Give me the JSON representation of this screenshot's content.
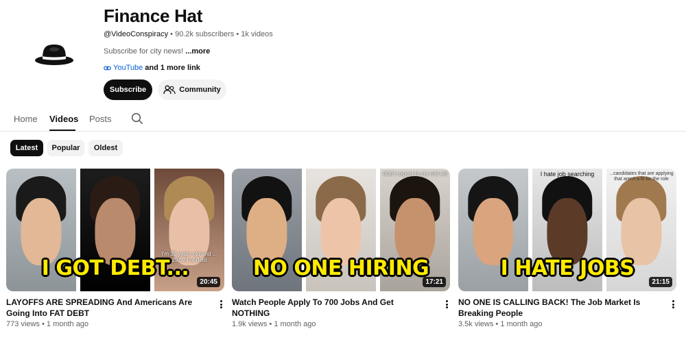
{
  "channel": {
    "title": "Finance Hat",
    "handle": "@VideoConspiracy",
    "subscribers": "90.2k subscribers",
    "videos_count": "1k videos",
    "separator": " • ",
    "description": "Subscribe for city news! ",
    "more_label": "...more",
    "link_label": "YouTube",
    "link_rest": "and 1 more link",
    "subscribe_label": "Subscribe",
    "community_label": "Community",
    "avatar_icon": "fedora-hat-icon"
  },
  "tabs": [
    {
      "label": "Home"
    },
    {
      "label": "Videos",
      "active": true
    },
    {
      "label": "Posts"
    }
  ],
  "chips": [
    {
      "label": "Latest",
      "active": true
    },
    {
      "label": "Popular"
    },
    {
      "label": "Oldest"
    }
  ],
  "videos": [
    {
      "thumb_caption": "I GOT DEBT...",
      "overlay_text": "I'm 35 years old and ... 292.74 of debt",
      "duration": "20:45",
      "title": "LAYOFFS ARE SPREADING And Americans Are Going Into FAT DEBT",
      "views": "773 views",
      "age": "1 month ago"
    },
    {
      "thumb_caption": "NO ONE HIRING",
      "overlay_text": "didn't expect to cry mid vid",
      "duration": "17:21",
      "title": "Watch People Apply To 700 Jobs And Get NOTHING",
      "views": "1.9k views",
      "age": "1 month ago"
    },
    {
      "thumb_caption": "I HATE JOBS",
      "overlay_text": "I hate job searching",
      "overlay_text_2": "...candidates that are applying that aren't a fit for the role",
      "duration": "21:15",
      "title": "NO ONE IS CALLING BACK! The Job Market Is Breaking People",
      "views": "3.5k views",
      "age": "1 month ago"
    }
  ],
  "colors": {
    "caption_yellow": "#ffeb00",
    "link_blue": "#065fd4",
    "text_primary": "#0f0f0f",
    "text_secondary": "#606060"
  }
}
